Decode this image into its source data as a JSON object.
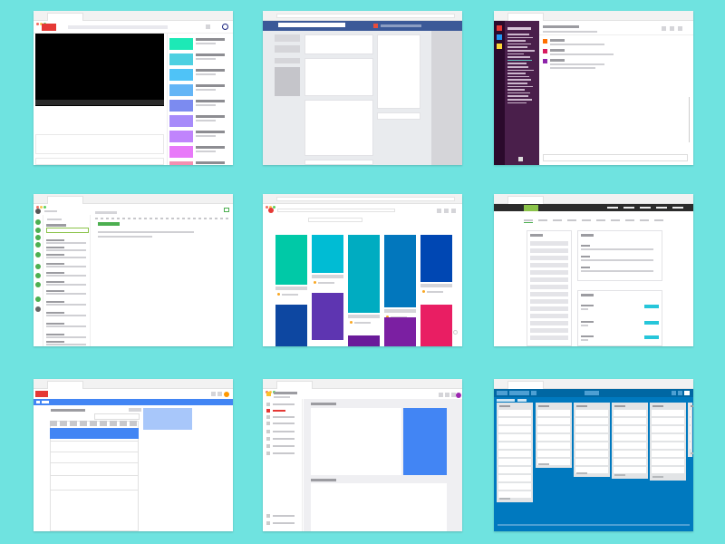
{
  "page": {
    "background": "#6fe3e0"
  },
  "windows": [
    {
      "name": "video-app-window",
      "accent": "#e53935",
      "thumb_colors": [
        "#1de9b6",
        "#4dd0e1",
        "#4fc3f7",
        "#64b5f6",
        "#7c8bf0",
        "#a78bfa",
        "#c084fc",
        "#e879f9",
        "#f48fb1"
      ]
    },
    {
      "name": "social-feed-window",
      "accent": "#3b5998"
    },
    {
      "name": "team-chat-window",
      "accent": "#3f0e40"
    },
    {
      "name": "email-inbox-window",
      "accent": "#4caf50"
    },
    {
      "name": "pinboard-window",
      "accent": "#e53935",
      "tile_colors": [
        "#00c9a7",
        "#00bcd4",
        "#00acc1",
        "#0277bd",
        "#0047b3",
        "#5e35b1",
        "#0d47a1",
        "#6a1b9a",
        "#7b1fa2",
        "#e91e63"
      ]
    },
    {
      "name": "dashboard-window",
      "accent": "#8bc34a"
    },
    {
      "name": "spreadsheet-window",
      "accent": "#e53935"
    },
    {
      "name": "docs-window",
      "accent": "#4285f4"
    },
    {
      "name": "kanban-board-window",
      "accent": "#0079bf"
    }
  ]
}
